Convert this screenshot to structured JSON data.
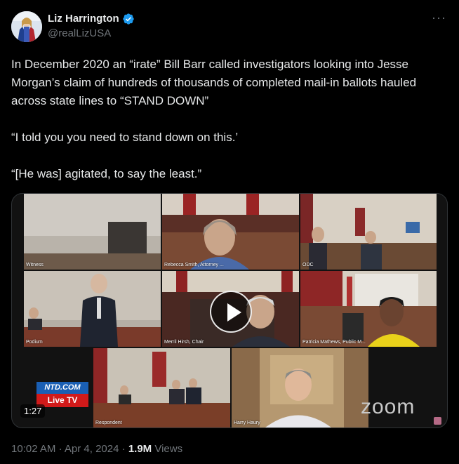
{
  "author": {
    "display_name": "Liz Harrington",
    "handle": "@realLizUSA",
    "verified": true,
    "verified_color": "#1d9bf0"
  },
  "more_label": "···",
  "tweet": {
    "paragraphs": [
      "In December 2020 an “irate” Bill Barr called investigators looking into Jesse Morgan’s claim of hundreds of thousands of completed mail-in ballots hauled across state lines to “STAND DOWN”",
      "“I told you you need to stand down on this.’",
      "“[He was] agitated, to say the least.”"
    ]
  },
  "video": {
    "duration": "1:27",
    "tiles": [
      {
        "label": "Witness"
      },
      {
        "label": "Rebecca Smith, Attorney ..."
      },
      {
        "label": "ODC"
      },
      {
        "label": "Podium"
      },
      {
        "label": "Merril Hirsh, Chair"
      },
      {
        "label": "Patricia Mathews, Public M..."
      },
      {
        "label": "Respondent"
      },
      {
        "label": "Harry Haury"
      }
    ],
    "ntd_top": "NTD.COM",
    "ntd_bottom": "Live TV",
    "zoom_text": "zoom"
  },
  "meta": {
    "time": "10:02 AM",
    "separator": "·",
    "date": "Apr 4, 2024",
    "views_count": "1.9M",
    "views_label": "Views"
  }
}
